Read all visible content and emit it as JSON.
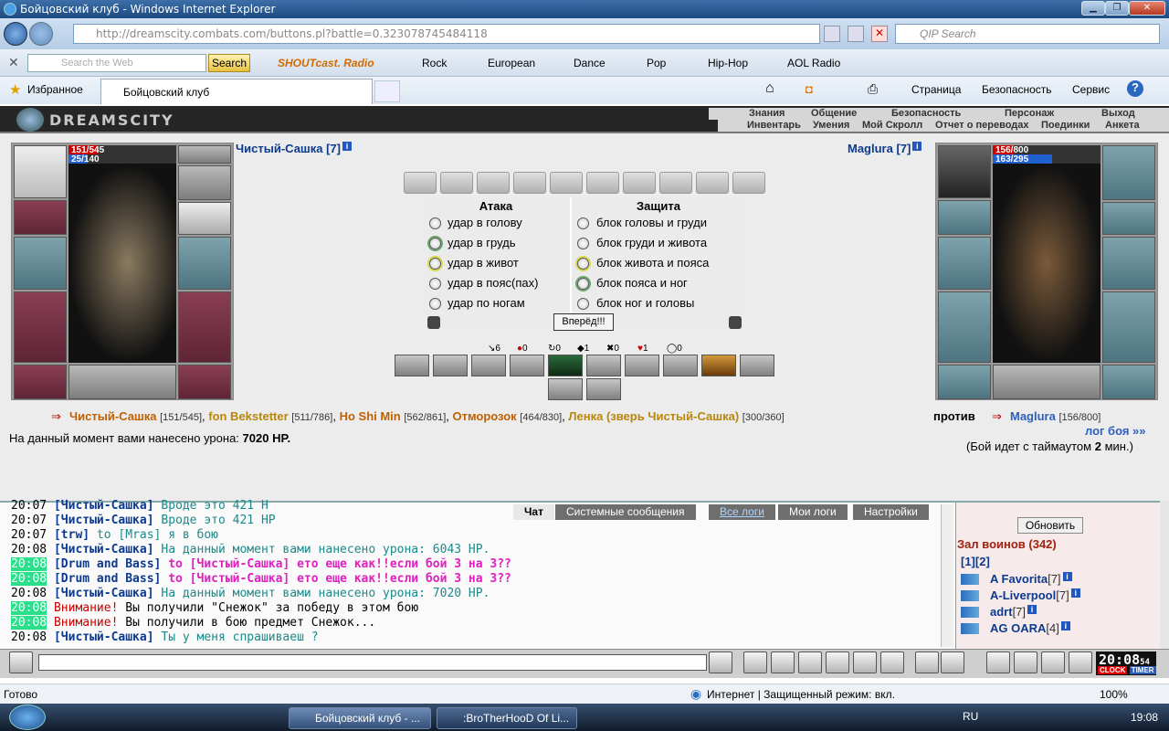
{
  "window": {
    "title": "Бойцовский клуб - Windows Internet Explorer"
  },
  "browser": {
    "url": "http://dreamscity.combats.com/buttons.pl?battle=0.323078745484118",
    "qip_placeholder": "QIP Search",
    "search_placeholder": "Search the Web",
    "search_button": "Search",
    "toolbar_items": [
      "SHOUTcast. Radio",
      "Rock",
      "European",
      "Dance",
      "Pop",
      "Hip-Hop",
      "AOL Radio"
    ],
    "favorites": "Избранное",
    "tab_title": "Бойцовский клуб",
    "commands": [
      "Страница",
      "Безопасность",
      "Сервис"
    ]
  },
  "game": {
    "logo": "DREAMSCITY",
    "menu_top": [
      "Знания",
      "Общение",
      "Безопасность",
      "Персонаж",
      "Выход"
    ],
    "menu_bottom": [
      "Инвентарь",
      "Умения",
      "Мой Скролл",
      "Отчет о переводах",
      "Поединки",
      "Анкета"
    ],
    "player_left": {
      "name": "Чистый-Сашка [7]",
      "hp": "151/545",
      "mp": "25/140",
      "hp_frac": 0.28,
      "mp_frac": 0.18
    },
    "player_right": {
      "name": "Maglura [7]",
      "hp": "156/800",
      "mp": "163/295",
      "hp_frac": 0.2,
      "mp_frac": 0.55
    },
    "attack_header": "Атака",
    "defense_header": "Защита",
    "attacks": [
      "удар в голову",
      "удар в грудь",
      "удар в живот",
      "удар в пояс(пах)",
      "удар по ногам"
    ],
    "blocks": [
      "блок головы и груди",
      "блок груди и живота",
      "блок живота и пояса",
      "блок пояса и ног",
      "блок ног и головы"
    ],
    "forward_button": "Вперёд!!!",
    "stats": [
      "6",
      "0",
      "0",
      "1",
      "0",
      "1",
      "0"
    ],
    "team_left": [
      {
        "name": "Чистый-Сашка",
        "hp": "[151/545]"
      },
      {
        "name": "fon Bekstetter",
        "hp": "[511/786]"
      },
      {
        "name": "Ho Shi Min",
        "hp": "[562/861]"
      },
      {
        "name": "Отморозок",
        "hp": "[464/830]"
      },
      {
        "name": "Ленка (зверь Чистый-Сашка)",
        "hp": "[300/360]"
      }
    ],
    "vs": "против",
    "team_right": [
      {
        "name": "Maglura",
        "hp": "[156/800]"
      }
    ],
    "damage_label": "На данный момент вами нанесено урона:",
    "damage_value": "7020 HP.",
    "log_link": "лог боя »»",
    "timeout_pre": "(Бой идет с таймаутом",
    "timeout_val": "2",
    "timeout_post": "мин.)"
  },
  "chat": {
    "tabs": [
      "Чат",
      "Системные сообщения",
      "Все логи",
      "Мои логи",
      "Настройки"
    ],
    "lines": [
      {
        "time": "20:07",
        "nick": "[Чистый-Сашка]",
        "text": "Вроде это 421 Н",
        "style": "normal"
      },
      {
        "time": "20:07",
        "nick": "[Чистый-Сашка]",
        "text": "Вроде это 421 HP",
        "style": "normal"
      },
      {
        "time": "20:07",
        "nick": "[trw]",
        "text": "to [Mras] я в бою",
        "style": "normal"
      },
      {
        "time": "20:08",
        "nick": "[Чистый-Сашка]",
        "text": "На данный момент вами нанесено урона: 6043 HP.",
        "style": "normal"
      },
      {
        "time": "20:08",
        "nick": "[Drum and Bass]",
        "text": "to [Чистый-Сашка] ето еще как!!если бой 3 на 3??",
        "style": "private"
      },
      {
        "time": "20:08",
        "nick": "[Drum and Bass]",
        "text": "to [Чистый-Сашка] ето еще как!!если бой 3 на 3??",
        "style": "private"
      },
      {
        "time": "20:08",
        "nick": "[Чистый-Сашка]",
        "text": "На данный момент вами нанесено урона: 7020 HP.",
        "style": "normal"
      },
      {
        "time": "20:08",
        "nick": "Внимание!",
        "text": "Вы получили \"Снежок\" за победу в этом бою",
        "style": "system"
      },
      {
        "time": "20:08",
        "nick": "Внимание!",
        "text": "Вы получили в бою предмет Снежок...",
        "style": "system"
      },
      {
        "time": "20:08",
        "nick": "[Чистый-Сашка]",
        "text": "Ты у меня спрашиваеш ?",
        "style": "normal"
      }
    ]
  },
  "room": {
    "refresh": "Обновить",
    "title": "Зал воинов (342)",
    "pages": "[1][2]",
    "users": [
      {
        "name": "A Favorita",
        "level": "[7]"
      },
      {
        "name": "A-Liverpool",
        "level": "[7]"
      },
      {
        "name": "adrt",
        "level": "[7]"
      },
      {
        "name": "AG OARA",
        "level": "[4]"
      }
    ]
  },
  "clock": {
    "time": "20:08",
    "sec": "54",
    "labels": [
      "CLOCK",
      "TIMER"
    ]
  },
  "statusbar": {
    "left": "Готово",
    "zone": "Интернет | Защищенный режим: вкл.",
    "zoom": "100%"
  },
  "taskbar": {
    "tasks": [
      "Бойцовский клуб - ...",
      ":BroTherHooD Of Li..."
    ],
    "lang": "RU",
    "time": "19:08"
  }
}
